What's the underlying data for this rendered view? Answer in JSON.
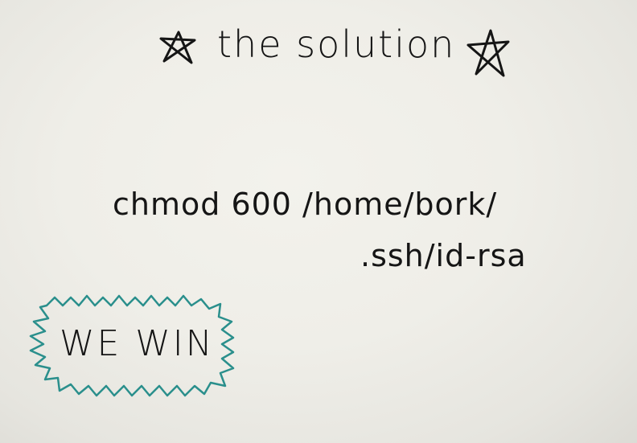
{
  "heading": "the solution",
  "command": {
    "line1": "chmod 600 /home/bork/",
    "line2": ".ssh/id-rsa"
  },
  "burst_text": "WE WIN",
  "colors": {
    "paper": "#efeee8",
    "ink": "#151515",
    "burst_outline": "#2a8f8c"
  },
  "icons": [
    "star-icon",
    "star-icon"
  ]
}
